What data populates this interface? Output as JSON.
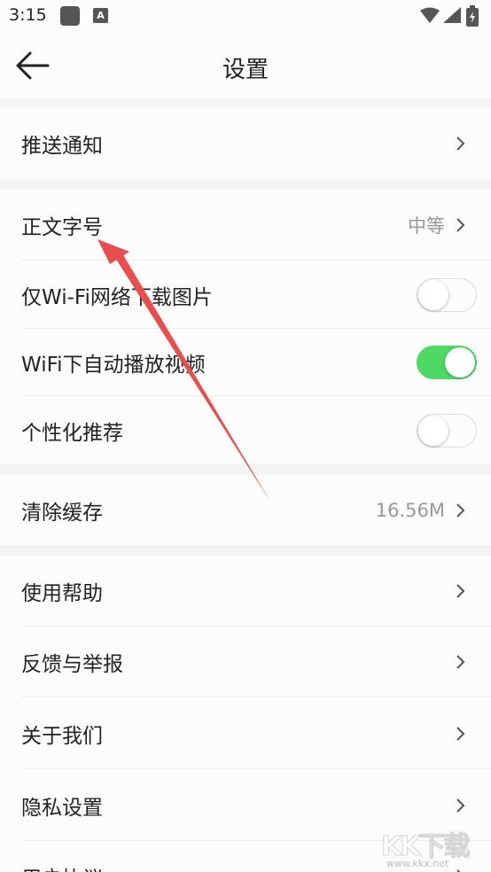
{
  "status_bar": {
    "time": "3:15",
    "icons": [
      "app-square-icon",
      "a-notification-icon",
      "wifi-icon",
      "signal-icon",
      "battery-icon"
    ]
  },
  "header": {
    "title": "设置",
    "back_icon": "back-arrow-icon"
  },
  "groups": [
    {
      "items": [
        {
          "label": "推送通知",
          "type": "nav"
        }
      ]
    },
    {
      "items": [
        {
          "label": "正文字号",
          "type": "nav",
          "value": "中等"
        },
        {
          "label": "仅Wi-Fi网络下载图片",
          "type": "toggle",
          "on": false
        },
        {
          "label": "WiFi下自动播放视频",
          "type": "toggle",
          "on": true
        },
        {
          "label": "个性化推荐",
          "type": "toggle",
          "on": false
        }
      ]
    },
    {
      "items": [
        {
          "label": "清除缓存",
          "type": "nav",
          "value": "16.56M"
        }
      ]
    },
    {
      "items": [
        {
          "label": "使用帮助",
          "type": "nav"
        },
        {
          "label": "反馈与举报",
          "type": "nav"
        },
        {
          "label": "关于我们",
          "type": "nav"
        },
        {
          "label": "隐私设置",
          "type": "nav"
        },
        {
          "label": "用户协议",
          "type": "nav"
        }
      ]
    }
  ],
  "watermark": {
    "text": "KK下载",
    "url": "www.kkx.net"
  },
  "colors": {
    "toggle_on": "#4cd964",
    "annotation_arrow": "#e84e4e",
    "page_background": "#f4f4f4",
    "row_background": "#fcfcfc"
  }
}
